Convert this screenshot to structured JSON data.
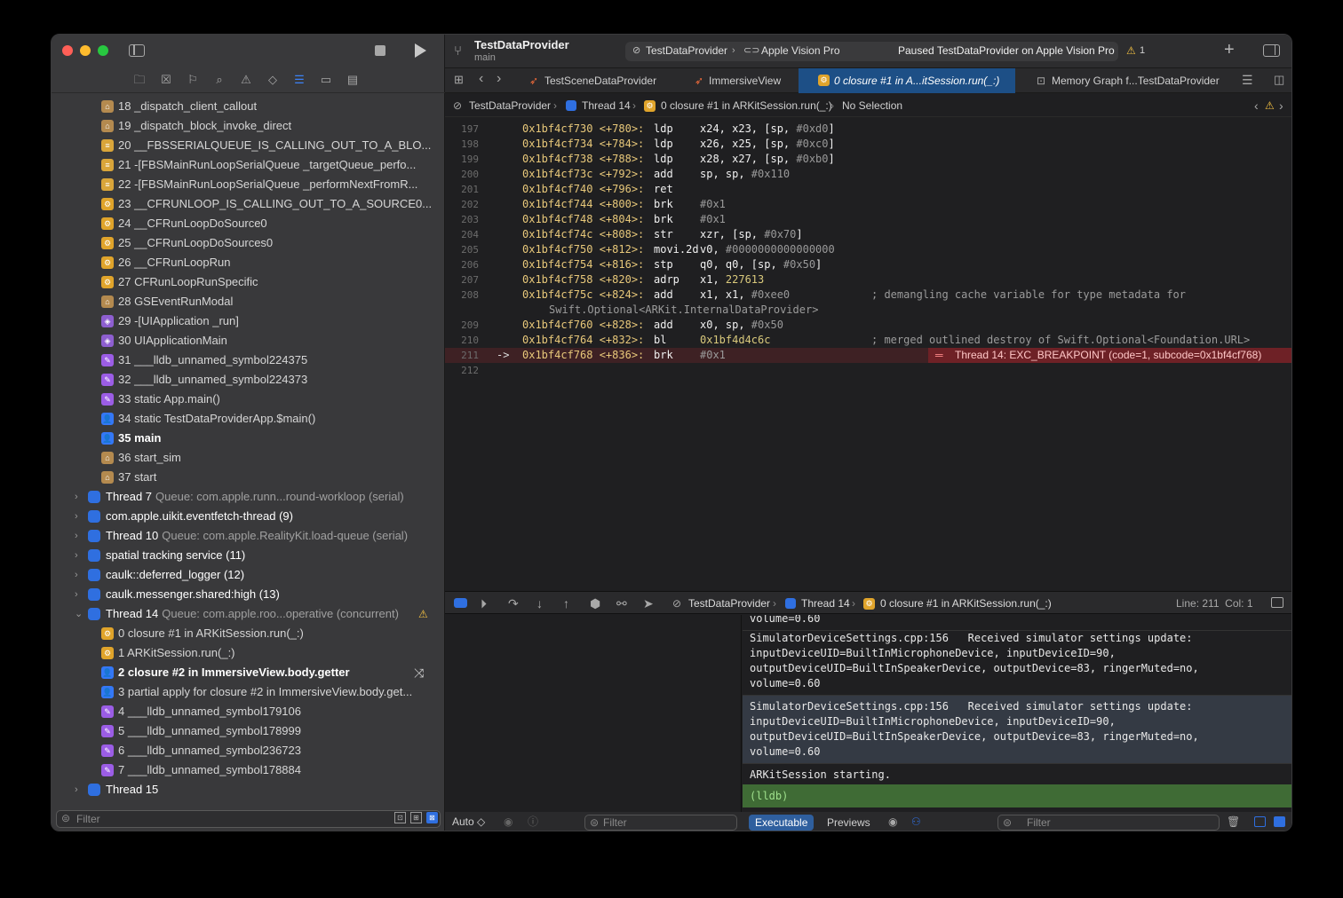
{
  "toolbar": {
    "project": "TestDataProvider",
    "branch": "main",
    "scheme": "TestDataProvider",
    "destination": "Apple Vision Pro",
    "status": "Paused TestDataProvider on Apple Vision Pro",
    "warnings": "1"
  },
  "tabs": [
    {
      "label": "TestSceneDataProvider"
    },
    {
      "label": "ImmersiveView"
    },
    {
      "label": "0 closure #1 in A...itSession.run(_:)"
    },
    {
      "label": "Memory Graph f...TestDataProvider"
    }
  ],
  "jumpbar": {
    "project": "TestDataProvider",
    "thread": "Thread 14",
    "frame": "0 closure #1 in ARKitSession.run(_:)",
    "selection": "No Selection"
  },
  "frames": [
    {
      "text": "18 _dispatch_client_callout",
      "icon": "building",
      "color": "#b48a4f"
    },
    {
      "text": "19 _dispatch_block_invoke_direct",
      "icon": "building",
      "color": "#b48a4f"
    },
    {
      "text": "20 __FBSSERIALQUEUE_IS_CALLING_OUT_TO_A_BLO...",
      "icon": "stack",
      "color": "#d9a53a"
    },
    {
      "text": "21 -[FBSMainRunLoopSerialQueue _targetQueue_perfo...",
      "icon": "stack",
      "color": "#d9a53a"
    },
    {
      "text": "22 -[FBSMainRunLoopSerialQueue _performNextFromR...",
      "icon": "stack",
      "color": "#d9a53a"
    },
    {
      "text": "23 __CFRUNLOOP_IS_CALLING_OUT_TO_A_SOURCE0...",
      "icon": "gear",
      "color": "#e0a42b"
    },
    {
      "text": "24 __CFRunLoopDoSource0",
      "icon": "gear",
      "color": "#e0a42b"
    },
    {
      "text": "25 __CFRunLoopDoSources0",
      "icon": "gear",
      "color": "#e0a42b"
    },
    {
      "text": "26 __CFRunLoopRun",
      "icon": "gear",
      "color": "#e0a42b"
    },
    {
      "text": "27 CFRunLoopRunSpecific",
      "icon": "gear",
      "color": "#e0a42b"
    },
    {
      "text": "28 GSEventRunModal",
      "icon": "building",
      "color": "#b48a4f"
    },
    {
      "text": "29 -[UIApplication _run]",
      "icon": "layers",
      "color": "#8e5fd0"
    },
    {
      "text": "30 UIApplicationMain",
      "icon": "layers",
      "color": "#8e5fd0"
    },
    {
      "text": "31 ___lldb_unnamed_symbol224375",
      "icon": "pencil",
      "color": "#9b5de5"
    },
    {
      "text": "32 ___lldb_unnamed_symbol224373",
      "icon": "pencil",
      "color": "#9b5de5"
    },
    {
      "text": "33 static App.main()",
      "icon": "pencil",
      "color": "#9b5de5"
    },
    {
      "text": "34 static TestDataProviderApp.$main()",
      "icon": "person",
      "color": "#3478f6"
    },
    {
      "text": "35 main",
      "icon": "person",
      "color": "#3478f6",
      "bold": true
    },
    {
      "text": "36 start_sim",
      "icon": "building",
      "color": "#b48a4f"
    },
    {
      "text": "37 start",
      "icon": "building",
      "color": "#b48a4f"
    }
  ],
  "threads_a": [
    {
      "name": "Thread 7",
      "queue": "Queue: com.apple.runn...round-workloop (serial)"
    },
    {
      "name": "com.apple.uikit.eventfetch-thread (9)",
      "queue": ""
    },
    {
      "name": "Thread 10",
      "queue": "Queue: com.apple.RealityKit.load-queue (serial)"
    },
    {
      "name": "spatial tracking service (11)",
      "queue": ""
    },
    {
      "name": "caulk::deferred_logger (12)",
      "queue": ""
    },
    {
      "name": "caulk.messenger.shared:high (13)",
      "queue": ""
    },
    {
      "name": "Thread 14",
      "queue": "Queue: com.apple.roo...operative (concurrent)"
    }
  ],
  "thread14_frames": [
    {
      "text": "0 closure #1 in ARKitSession.run(_:)",
      "icon": "gear",
      "color": "#e0a42b"
    },
    {
      "text": "1 ARKitSession.run(_:)",
      "icon": "gear",
      "color": "#e0a42b"
    },
    {
      "text": "2 closure #2 in ImmersiveView.body.getter",
      "icon": "person",
      "color": "#3478f6",
      "bold": true
    },
    {
      "text": "3 partial apply for closure #2 in ImmersiveView.body.get...",
      "icon": "person",
      "color": "#3478f6"
    },
    {
      "text": "4 ___lldb_unnamed_symbol179106",
      "icon": "pencil",
      "color": "#9b5de5"
    },
    {
      "text": "5 ___lldb_unnamed_symbol178999",
      "icon": "pencil",
      "color": "#9b5de5"
    },
    {
      "text": "6 ___lldb_unnamed_symbol236723",
      "icon": "pencil",
      "color": "#9b5de5"
    },
    {
      "text": "7 ___lldb_unnamed_symbol178884",
      "icon": "pencil",
      "color": "#9b5de5"
    }
  ],
  "thread15": {
    "name": "Thread 15"
  },
  "nav_filter": {
    "placeholder": "Filter"
  },
  "code": [
    {
      "ln": "197",
      "addr": "0x1bf4cf730 <+780>:",
      "op": "ldp",
      "args": "x24, x23, [sp, ",
      "imm": "#0xd0",
      "tail": "]"
    },
    {
      "ln": "198",
      "addr": "0x1bf4cf734 <+784>:",
      "op": "ldp",
      "args": "x26, x25, [sp, ",
      "imm": "#0xc0",
      "tail": "]"
    },
    {
      "ln": "199",
      "addr": "0x1bf4cf738 <+788>:",
      "op": "ldp",
      "args": "x28, x27, [sp, ",
      "imm": "#0xb0",
      "tail": "]"
    },
    {
      "ln": "200",
      "addr": "0x1bf4cf73c <+792>:",
      "op": "add",
      "args": "sp, sp, ",
      "imm": "#0x110",
      "tail": ""
    },
    {
      "ln": "201",
      "addr": "0x1bf4cf740 <+796>:",
      "op": "ret",
      "args": "",
      "imm": "",
      "tail": ""
    },
    {
      "ln": "202",
      "addr": "0x1bf4cf744 <+800>:",
      "op": "brk",
      "args": "",
      "imm": "#0x1",
      "tail": ""
    },
    {
      "ln": "203",
      "addr": "0x1bf4cf748 <+804>:",
      "op": "brk",
      "args": "",
      "imm": "#0x1",
      "tail": ""
    },
    {
      "ln": "204",
      "addr": "0x1bf4cf74c <+808>:",
      "op": "str",
      "args": "xzr, [sp, ",
      "imm": "#0x70",
      "tail": "]"
    },
    {
      "ln": "205",
      "addr": "0x1bf4cf750 <+812>:",
      "op": "movi.2d",
      "args": "v0, ",
      "imm": "#0000000000000000",
      "tail": ""
    },
    {
      "ln": "206",
      "addr": "0x1bf4cf754 <+816>:",
      "op": "stp",
      "args": "q0, q0, [sp, ",
      "imm": "#0x50",
      "tail": "]"
    },
    {
      "ln": "207",
      "addr": "0x1bf4cf758 <+820>:",
      "op": "adrp",
      "args": "x1, ",
      "imm": "",
      "num": "227613",
      "tail": ""
    },
    {
      "ln": "208",
      "addr": "0x1bf4cf75c <+824>:",
      "op": "add",
      "args": "x1, x1, ",
      "imm": "#0xee0",
      "tail": "",
      "comment": "; demangling cache variable for type metadata for",
      "comment2": "Swift.Optional<ARKit.InternalDataProvider>"
    },
    {
      "ln": "209",
      "addr": "0x1bf4cf760 <+828>:",
      "op": "add",
      "args": "x0, sp, ",
      "imm": "#0x50",
      "tail": ""
    },
    {
      "ln": "210",
      "addr": "0x1bf4cf764 <+832>:",
      "op": "bl",
      "args": "",
      "imm": "",
      "num": "0x1bf4d4c6c",
      "tail": "",
      "comment": "; merged outlined destroy of Swift.Optional<Foundation.URL>"
    },
    {
      "ln": "211",
      "addr": "0x1bf4cf768 <+836>:",
      "op": "brk",
      "args": "",
      "imm": "#0x1",
      "tail": "",
      "arrow": "->"
    },
    {
      "ln": "212",
      "addr": "",
      "op": "",
      "args": "",
      "imm": "",
      "tail": ""
    }
  ],
  "breakpoint_msg": "Thread 14: EXC_BREAKPOINT (code=1, subcode=0x1bf4cf768)",
  "debugbar": {
    "project": "TestDataProvider",
    "thread": "Thread 14",
    "frame": "0 closure #1 in ARKitSession.run(_:)",
    "position": "Line: 211  Col: 1"
  },
  "console": {
    "top_fragment": "volume=0.60",
    "log1": "SimulatorDeviceSettings.cpp:156   Received simulator settings update:\ninputDeviceUID=BuiltInMicrophoneDevice, inputDeviceID=90,\noutputDeviceUID=BuiltInSpeakerDevice, outputDevice=83, ringerMuted=no,\nvolume=0.60",
    "log2": "SimulatorDeviceSettings.cpp:156   Received simulator settings update:\ninputDeviceUID=BuiltInMicrophoneDevice, inputDeviceID=90,\noutputDeviceUID=BuiltInSpeakerDevice, outputDevice=83, ringerMuted=no,\nvolume=0.60",
    "log3": "ARKitSession starting.",
    "prompt": "(lldb)"
  },
  "bottom": {
    "auto": "Auto ◇",
    "var_filter": "Filter",
    "executable": "Executable",
    "previews": "Previews",
    "console_filter": "Filter"
  }
}
